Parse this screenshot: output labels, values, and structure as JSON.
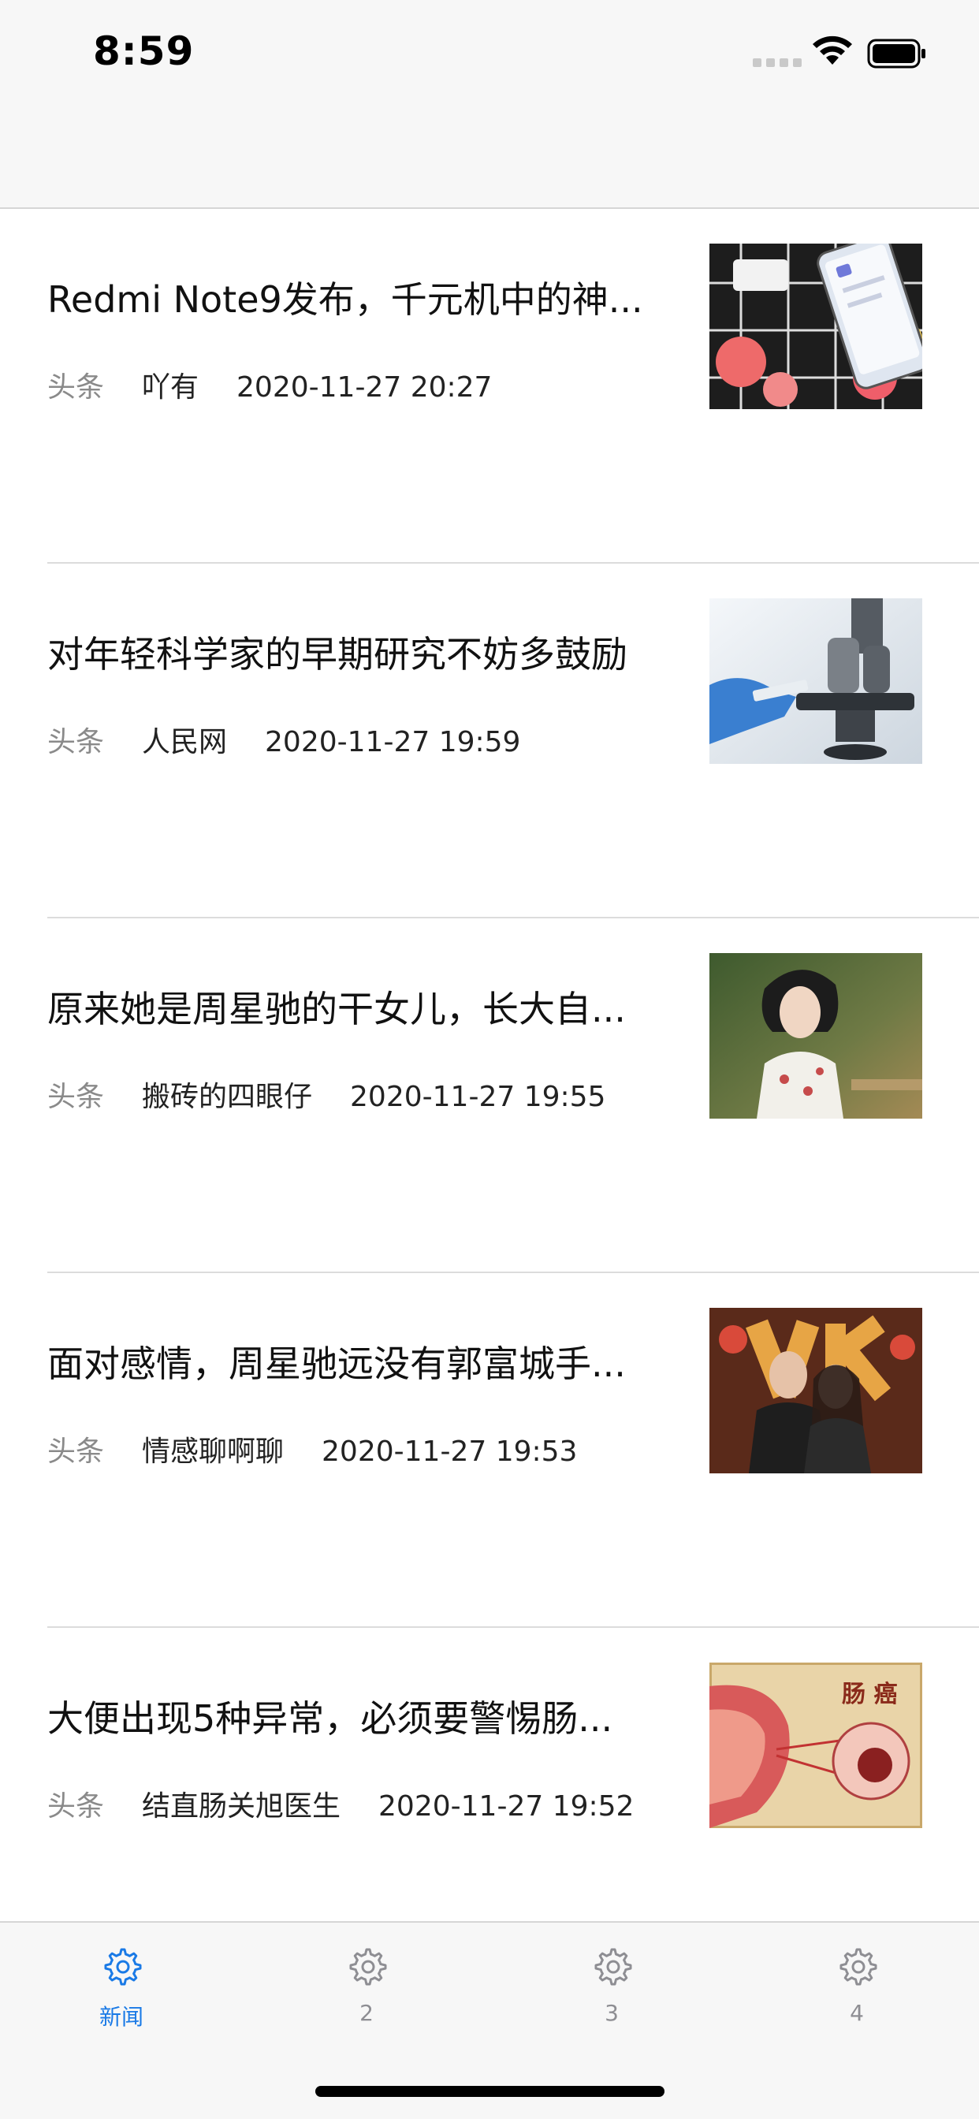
{
  "status_bar": {
    "time": "8:59"
  },
  "news": [
    {
      "title": "Redmi Note9发布，千元机中的神...",
      "category": "头条",
      "source": "吖有",
      "time": "2020-11-27 20:27",
      "thumb": "phone-photo"
    },
    {
      "title": "对年轻科学家的早期研究不妨多鼓励",
      "category": "头条",
      "source": "人民网",
      "time": "2020-11-27 19:59",
      "thumb": "microscope-photo"
    },
    {
      "title": "原来她是周星驰的干女儿，长大自...",
      "category": "头条",
      "source": "搬砖的四眼仔",
      "time": "2020-11-27 19:55",
      "thumb": "portrait-photo"
    },
    {
      "title": "面对感情，周星驰远没有郭富城手...",
      "category": "头条",
      "source": "情感聊啊聊",
      "time": "2020-11-27 19:53",
      "thumb": "couple-photo"
    },
    {
      "title": "大便出现5种异常，必须要警惕肠...",
      "category": "头条",
      "source": "结直肠关旭医生",
      "time": "2020-11-27 19:52",
      "thumb": "medical-illustration",
      "thumb_text": "肠 癌"
    }
  ],
  "tabbar": {
    "tabs": [
      {
        "label": "新闻",
        "icon": "gear-icon",
        "active": true
      },
      {
        "label": "2",
        "icon": "gear-icon",
        "active": false
      },
      {
        "label": "3",
        "icon": "gear-icon",
        "active": false
      },
      {
        "label": "4",
        "icon": "gear-icon",
        "active": false
      }
    ]
  },
  "colors": {
    "accent": "#1a7ae6",
    "inactive": "#8e8e93",
    "category": "#8a8a8a"
  }
}
